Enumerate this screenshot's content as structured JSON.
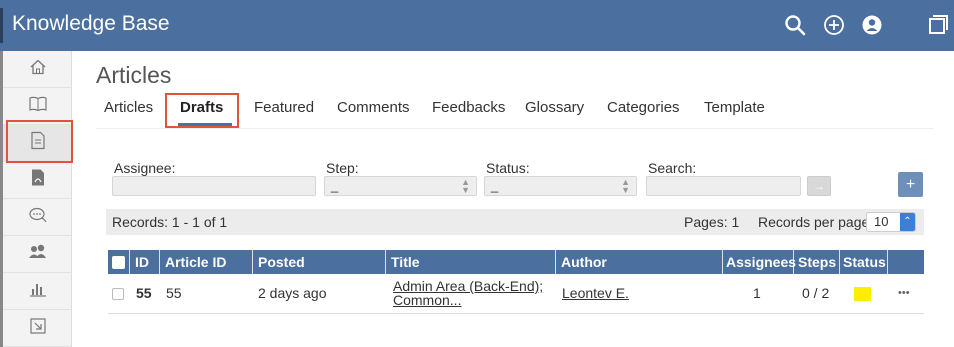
{
  "app": {
    "title": "Knowledge Base",
    "top_icons": [
      "search-icon",
      "add-circle-icon",
      "user-icon",
      "window-icon"
    ]
  },
  "sidebar": {
    "items": [
      {
        "icon": "home-icon"
      },
      {
        "icon": "book-icon"
      },
      {
        "icon": "document-icon",
        "active": true
      },
      {
        "icon": "pdf-file-icon"
      },
      {
        "icon": "comments-icon"
      },
      {
        "icon": "users-icon"
      },
      {
        "icon": "bar-chart-icon"
      },
      {
        "icon": "export-icon"
      }
    ]
  },
  "page": {
    "title": "Articles",
    "tabs": [
      {
        "label": "Articles"
      },
      {
        "label": "Drafts",
        "active": true
      },
      {
        "label": "Featured"
      },
      {
        "label": "Comments"
      },
      {
        "label": "Feedbacks"
      },
      {
        "label": "Glossary"
      },
      {
        "label": "Categories"
      },
      {
        "label": "Template"
      }
    ]
  },
  "filters": {
    "assignee_label": "Assignee:",
    "step_label": "Step:",
    "step_value": "_",
    "status_label": "Status:",
    "status_value": "_",
    "search_label": "Search:",
    "search_value": "",
    "search_button": "→",
    "add_button": "+"
  },
  "records": {
    "summary": "Records: 1 - 1 of 1",
    "pages": "Pages: 1",
    "per_page_label": "Records per page:",
    "per_page_value": "10"
  },
  "table": {
    "columns": [
      "ID",
      "Article ID",
      "Posted",
      "Title",
      "Author",
      "Assignees",
      "Steps",
      "Status"
    ],
    "rows": [
      {
        "id": "55",
        "article_id": "55",
        "posted": "2 days ago",
        "title_line1": "Admin Area (Back-End);",
        "title_line2": "Common...",
        "author": "Leontev E.",
        "assignees": "1",
        "steps": "0 / 2",
        "status_color": "#ffee00",
        "more": "•••"
      }
    ]
  },
  "colors": {
    "header": "#4b6f9e",
    "highlight": "#e0533c",
    "accent": "#3b7fd6"
  }
}
